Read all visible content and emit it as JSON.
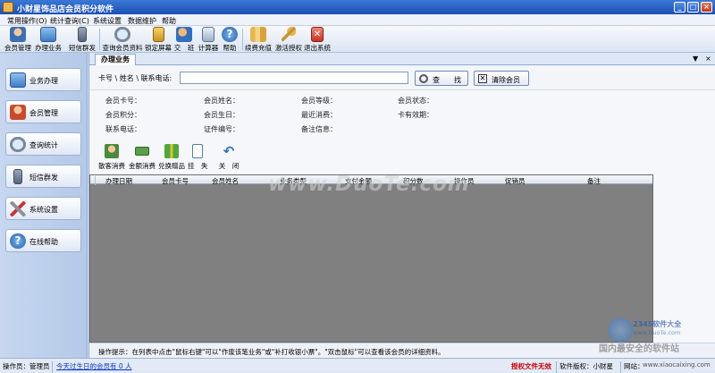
{
  "window": {
    "title": "小财星饰品店会员积分软件",
    "controls": [
      "_",
      "□",
      "×"
    ]
  },
  "menu": [
    "常用操作(O)",
    "统计查询(C)",
    "系统设置",
    "数据维护",
    "帮助"
  ],
  "toolbar": [
    {
      "label": "会员管理",
      "icon": "member-icon"
    },
    {
      "label": "办理业务",
      "icon": "business-icon"
    },
    {
      "label": "短信群发",
      "icon": "phone-icon"
    },
    {
      "label": "查询会员资料",
      "icon": "magnifier-icon"
    },
    {
      "label": "锁定屏幕",
      "icon": "lock-icon"
    },
    {
      "label": "交　班",
      "icon": "shift-icon"
    },
    {
      "label": "计算器",
      "icon": "calculator-icon"
    },
    {
      "label": "帮助",
      "icon": "help-icon"
    },
    {
      "label": "续费充值",
      "icon": "recharge-icon"
    },
    {
      "label": "激活授权",
      "icon": "key-icon"
    },
    {
      "label": "退出系统",
      "icon": "exit-icon"
    }
  ],
  "sidebar": [
    {
      "label": "业务办理",
      "icon": "business-icon"
    },
    {
      "label": "会员管理",
      "icon": "member-icon"
    },
    {
      "label": "查询统计",
      "icon": "magnifier-icon"
    },
    {
      "label": "短信群发",
      "icon": "phone-icon"
    },
    {
      "label": "系统设置",
      "icon": "tools-icon"
    },
    {
      "label": "在线帮助",
      "icon": "help-icon"
    }
  ],
  "tab": {
    "label": "办理业务",
    "controls": [
      "▼",
      "×"
    ]
  },
  "search": {
    "label": "卡号 \\ 姓名 \\ 联系电话:",
    "value": "",
    "find_button": "查　　找",
    "clear_button": "清除会员"
  },
  "info": {
    "card_no": "会员卡号：",
    "name": "会员姓名：",
    "level": "会员等级：",
    "status": "会员状态：",
    "points": "会员积分：",
    "birthday": "会员生日：",
    "recent": "最近消费：",
    "card_expiry": "卡有效期：",
    "phone": "联系电话：",
    "id_no": "证件编号：",
    "remark": "备注信息："
  },
  "actions": [
    {
      "label": "散客消费",
      "icon": "customer-icon"
    },
    {
      "label": "金额消费",
      "icon": "cash-icon"
    },
    {
      "label": "兑换赠品",
      "icon": "gift-icon"
    },
    {
      "label": "挂　失",
      "icon": "report-loss-icon"
    },
    {
      "label": "关　闭",
      "icon": "close-arrow-icon"
    }
  ],
  "table": {
    "columns": [
      "办理日期",
      "会员卡号",
      "会员姓名",
      "业务类型",
      "支付金额",
      "积分数",
      "操作员",
      "促销员",
      "备注"
    ],
    "rows": []
  },
  "hint": "操作提示：在列表中点击\"鼠标右键\"可以\"作废该笔业务\"或\"补打收银小票\"。\"双击鼠标\"可以查看该会员的详细资料。",
  "watermark": {
    "main": "www.DuoTe.com",
    "brand": "2345软件大全",
    "url": "www.DuoTe.com",
    "slogan": "国内最安全的软件站"
  },
  "status": {
    "operator_label": "操作员：",
    "operator": "管理员",
    "birthday_link": "今天过生日的会员有 0 人",
    "license": "授权文件无效",
    "copyright": "软件版权：小财星",
    "website_label": "网站：",
    "website": "www.xiaocaixing.com"
  },
  "colors": {
    "titlebar": "#1c4fb3",
    "grid_background": "#808080",
    "license_warning": "#cc0000",
    "link": "#0033cc"
  }
}
